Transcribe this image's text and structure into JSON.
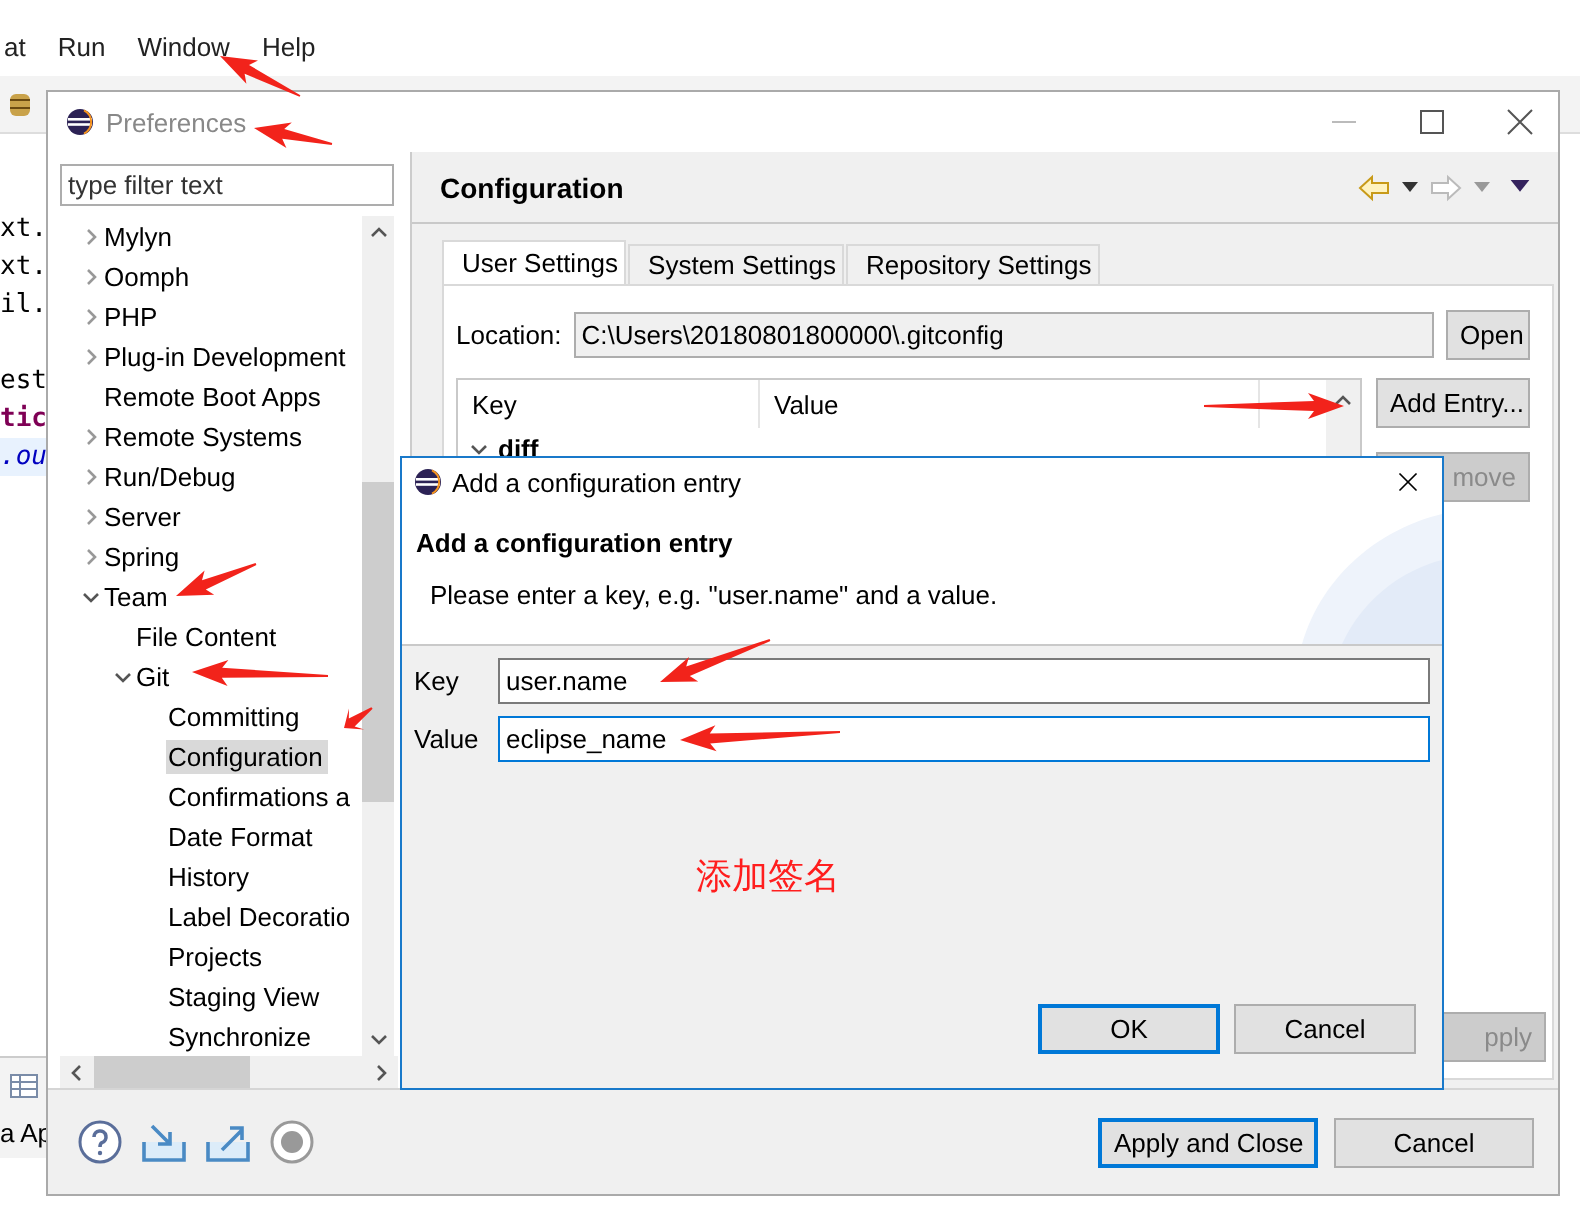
{
  "ide": {
    "menu": [
      "at",
      "Run",
      "Window",
      "Help"
    ],
    "code_fragments": [
      {
        "text": "xt.",
        "kind": "plain"
      },
      {
        "text": "xt.",
        "kind": "plain"
      },
      {
        "text": "il.",
        "kind": "plain"
      },
      {
        "text": "est",
        "kind": "plain"
      },
      {
        "text": "tic",
        "kind": "keyword"
      },
      {
        "text": ".ou",
        "kind": "field"
      }
    ],
    "bottom_tab": "a Ap"
  },
  "preferences": {
    "title": "Preferences",
    "filter": {
      "placeholder": "type filter text"
    },
    "tree": [
      {
        "label": "Mylyn",
        "expanded": false
      },
      {
        "label": "Oomph",
        "expanded": false
      },
      {
        "label": "PHP",
        "expanded": false
      },
      {
        "label": "Plug-in Development",
        "expanded": false
      },
      {
        "label": "Remote Boot Apps"
      },
      {
        "label": "Remote Systems",
        "expanded": false
      },
      {
        "label": "Run/Debug",
        "expanded": false
      },
      {
        "label": "Server",
        "expanded": false
      },
      {
        "label": "Spring",
        "expanded": false
      },
      {
        "label": "Team",
        "expanded": true,
        "children": [
          {
            "label": "File Content"
          },
          {
            "label": "Git",
            "expanded": true,
            "children": [
              {
                "label": "Committing",
                "selected": false
              },
              {
                "label": "Configuration",
                "selected": true
              },
              {
                "label": "Confirmations a",
                "selected": false
              },
              {
                "label": "Date Format",
                "selected": false
              },
              {
                "label": "History",
                "selected": false
              },
              {
                "label": "Label Decoratio",
                "selected": false
              },
              {
                "label": "Projects",
                "selected": false
              },
              {
                "label": "Staging View",
                "selected": false
              },
              {
                "label": "Synchronize",
                "selected": false
              }
            ]
          }
        ]
      }
    ],
    "page_title": "Configuration",
    "tabs": [
      {
        "label": "User Settings",
        "selected": true
      },
      {
        "label": "System Settings",
        "selected": false
      },
      {
        "label": "Repository Settings",
        "selected": false
      }
    ],
    "location": {
      "label": "Location:",
      "value": "C:\\Users\\20180801800000\\.gitconfig",
      "button": "Open"
    },
    "table": {
      "columns": [
        "Key",
        "Value"
      ],
      "rows": [
        {
          "key": "diff",
          "expanded": true
        }
      ]
    },
    "side_buttons": [
      {
        "label": "Add Entry...",
        "disabled": false
      },
      {
        "label": "move",
        "disabled": true
      }
    ],
    "apply_button": {
      "label": "pply",
      "disabled": true
    },
    "footer_buttons": [
      {
        "label": "Apply and Close",
        "default": true
      },
      {
        "label": "Cancel",
        "default": false
      }
    ]
  },
  "dialog": {
    "title": "Add a configuration entry",
    "heading": "Add a configuration entry",
    "message": "Please enter a key, e.g. \"user.name\" and a value.",
    "fields": [
      {
        "label": "Key",
        "value": "user.name",
        "focused": false
      },
      {
        "label": "Value",
        "value": "eclipse_name",
        "focused": true
      }
    ],
    "buttons": [
      {
        "label": "OK",
        "default": true
      },
      {
        "label": "Cancel",
        "default": false
      }
    ]
  },
  "annotation_text": "添加签名"
}
